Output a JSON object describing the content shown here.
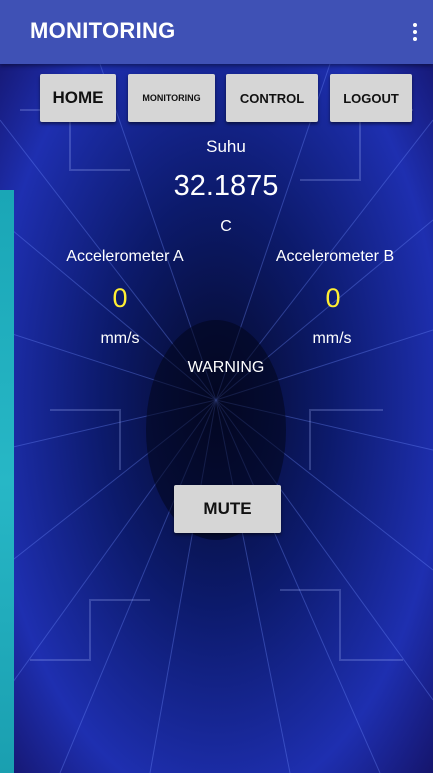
{
  "app_bar": {
    "title": "MONITORING",
    "menu_icon": "overflow-vertical-icon"
  },
  "nav": {
    "home_label": "HOME",
    "monitoring_label": "MONITORING",
    "control_label": "CONTROL",
    "logout_label": "LOGOUT"
  },
  "temperature": {
    "label": "Suhu",
    "value": "32.1875",
    "unit": "C"
  },
  "accelerometer_a": {
    "label": "Accelerometer A",
    "value": "0",
    "unit": "mm/s"
  },
  "accelerometer_b": {
    "label": "Accelerometer B",
    "value": "0",
    "unit": "mm/s"
  },
  "status": {
    "warning_text": "WARNING"
  },
  "actions": {
    "mute_label": "MUTE"
  },
  "colors": {
    "app_bar": "#3f51b5",
    "button_bg": "#d6d6d6",
    "value_highlight": "#ffee33",
    "background": "#0a0f3a"
  }
}
